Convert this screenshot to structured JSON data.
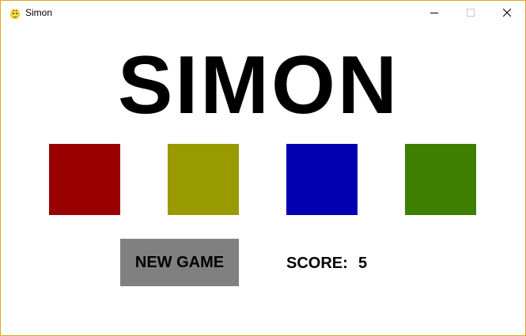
{
  "window": {
    "title": "Simon",
    "app_icon": "pygame-snake-icon",
    "controls": {
      "minimize_icon": "minimize-icon",
      "maximize_icon": "maximize-icon",
      "close_icon": "close-icon"
    },
    "border_color": "#e3a21a"
  },
  "game": {
    "title": "SIMON",
    "squares": [
      {
        "name": "red",
        "color": "#990000"
      },
      {
        "name": "yellow",
        "color": "#999900"
      },
      {
        "name": "blue",
        "color": "#0000b3"
      },
      {
        "name": "green",
        "color": "#3f7f00"
      }
    ],
    "new_game_label": "NEW GAME",
    "new_game_color": "#808080",
    "score_label": "SCORE:",
    "score_value": "5"
  }
}
